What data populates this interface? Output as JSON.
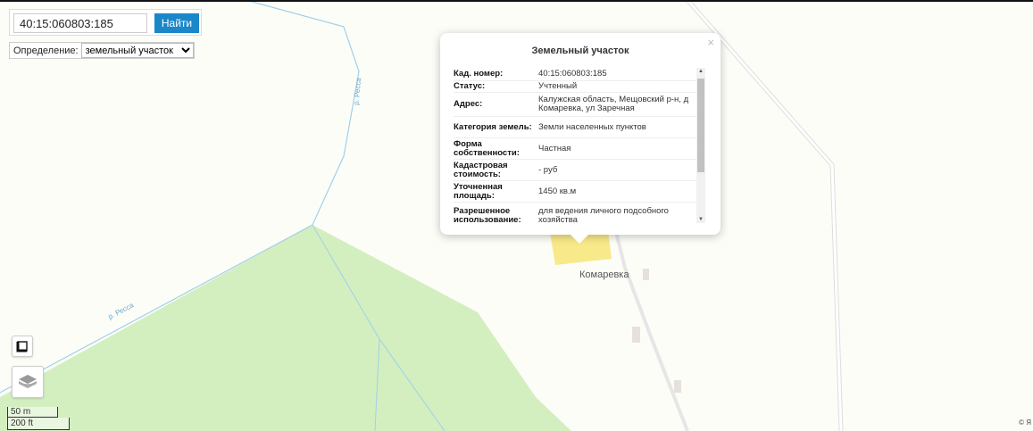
{
  "search": {
    "value": "40:15:060803:185",
    "button": "Найти"
  },
  "definition": {
    "label": "Определение:",
    "selected": "земельный участок"
  },
  "map": {
    "labels": {
      "river_1": "р. Ресса",
      "river_2": "р. Ресса",
      "village": "Комаревка"
    },
    "scale": {
      "metric": "50 m",
      "imperial": "200 ft"
    },
    "copyright": "© Я",
    "colors": {
      "forest": "#d3efc0",
      "water": "#9fd0e8",
      "plot": "#f8e98a",
      "background": "#fdfdf8",
      "building": "#e6e1dc"
    }
  },
  "popup": {
    "title": "Земельный участок",
    "close": "×",
    "rows": [
      {
        "key": "Кад. номер:",
        "value": "40:15:060803:185"
      },
      {
        "key": "Статус:",
        "value": "Учтенный"
      },
      {
        "key": "Адрес:",
        "value": "Калужская область, Мещовский р-н, д Комаревка, ул Заречная"
      },
      {
        "key": "Категория земель:",
        "value": "Земли населенных пунктов"
      },
      {
        "key": "Форма собственности:",
        "value": "Частная"
      },
      {
        "key": "Кадастровая стоимость:",
        "value": "- руб"
      },
      {
        "key": "Уточненная площадь:",
        "value": "1450 кв.м"
      },
      {
        "key": "Разрешенное использование:",
        "value": "для ведения личного подсобного хозяйства"
      }
    ]
  },
  "controls": {
    "fullscreen_icon": "fullscreen-icon",
    "layers_icon": "layers-icon"
  }
}
